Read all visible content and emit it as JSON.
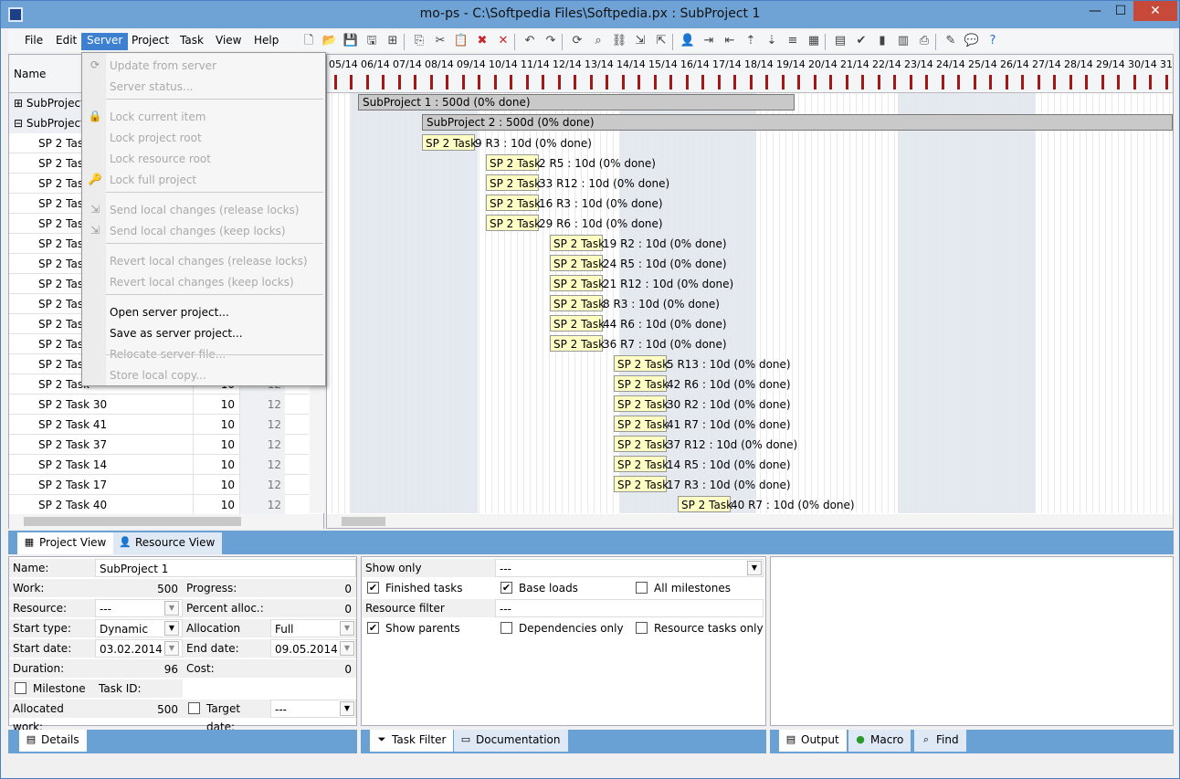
{
  "window": {
    "title": "mo-ps - C:\\Softpedia Files\\Softpedia.px : SubProject 1"
  },
  "menubar": [
    "File",
    "Edit",
    "Server",
    "Project",
    "Task",
    "View",
    "Help"
  ],
  "server_menu": {
    "items": [
      {
        "label": "Update from server",
        "enabled": false
      },
      {
        "label": "Server status...",
        "enabled": false
      },
      {
        "label": "Lock current item",
        "enabled": false
      },
      {
        "label": "Lock project root",
        "enabled": false
      },
      {
        "label": "Lock resource root",
        "enabled": false
      },
      {
        "label": "Lock full project",
        "enabled": false
      },
      {
        "label": "Send local changes (release locks)",
        "enabled": false
      },
      {
        "label": "Send local changes (keep locks)",
        "enabled": false
      },
      {
        "label": "Revert local changes (release locks)",
        "enabled": false
      },
      {
        "label": "Revert local changes (keep locks)",
        "enabled": false
      },
      {
        "label": "Open server project...",
        "enabled": true
      },
      {
        "label": "Save as server project...",
        "enabled": true
      },
      {
        "label": "Relocate server file...",
        "enabled": false
      },
      {
        "label": "Store local copy...",
        "enabled": false
      }
    ]
  },
  "grid": {
    "header_name": "Name",
    "rows": [
      {
        "name": "SubProject",
        "dur": "",
        "wk": "",
        "group": true,
        "marker": "⊞"
      },
      {
        "name": "SubProject",
        "dur": "",
        "wk": "",
        "group": true,
        "marker": "⊟"
      },
      {
        "name": "SP 2 Task",
        "dur": "",
        "wk": ""
      },
      {
        "name": "SP 2 Task",
        "dur": "",
        "wk": ""
      },
      {
        "name": "SP 2 Task",
        "dur": "",
        "wk": ""
      },
      {
        "name": "SP 2 Task",
        "dur": "",
        "wk": ""
      },
      {
        "name": "SP 2 Task",
        "dur": "",
        "wk": ""
      },
      {
        "name": "SP 2 Task",
        "dur": "",
        "wk": ""
      },
      {
        "name": "SP 2 Task",
        "dur": "",
        "wk": ""
      },
      {
        "name": "SP 2 Task",
        "dur": "",
        "wk": ""
      },
      {
        "name": "SP 2 Task",
        "dur": "",
        "wk": ""
      },
      {
        "name": "SP 2 Task",
        "dur": "",
        "wk": ""
      },
      {
        "name": "SP 2 Task",
        "dur": "",
        "wk": ""
      },
      {
        "name": "SP 2 Task",
        "dur": "",
        "wk": ""
      },
      {
        "name": "SP 2 Task",
        "dur": "10",
        "wk": "12"
      },
      {
        "name": "SP 2 Task 30",
        "dur": "10",
        "wk": "12"
      },
      {
        "name": "SP 2 Task 41",
        "dur": "10",
        "wk": "12"
      },
      {
        "name": "SP 2 Task 37",
        "dur": "10",
        "wk": "12"
      },
      {
        "name": "SP 2 Task 14",
        "dur": "10",
        "wk": "12"
      },
      {
        "name": "SP 2 Task 17",
        "dur": "10",
        "wk": "12"
      },
      {
        "name": "SP 2 Task 40",
        "dur": "10",
        "wk": "12"
      }
    ]
  },
  "gantt": {
    "dates": [
      "05/14",
      "06/14",
      "07/14",
      "08/14",
      "09/14",
      "10/14",
      "11/14",
      "12/14",
      "13/14",
      "14/14",
      "15/14",
      "16/14",
      "17/14",
      "18/14",
      "19/14",
      "20/14",
      "21/14",
      "22/14",
      "23/14",
      "24/14",
      "25/14",
      "26/14",
      "27/14",
      "28/14",
      "29/14",
      "30/14",
      "31/"
    ],
    "summary_bars": [
      {
        "label": "SubProject 1  : 500d (0% done)"
      },
      {
        "label": "SubProject 2  : 500d (0% done)"
      }
    ],
    "tasks": [
      {
        "box": "SP 2 Task",
        "rest": "9 R3 : 10d (0% done)",
        "col": 0
      },
      {
        "box": "SP 2 Task",
        "rest": "2 R5 : 10d (0% done)",
        "col": 1
      },
      {
        "box": "SP 2 Task",
        "rest": "33 R12 : 10d (0% done)",
        "col": 1
      },
      {
        "box": "SP 2 Task",
        "rest": "16 R3 : 10d (0% done)",
        "col": 1
      },
      {
        "box": "SP 2 Task",
        "rest": "29 R6 : 10d (0% done)",
        "col": 1
      },
      {
        "box": "SP 2 Task",
        "rest": "19 R2 : 10d (0% done)",
        "col": 2
      },
      {
        "box": "SP 2 Task",
        "rest": "24 R5 : 10d (0% done)",
        "col": 2
      },
      {
        "box": "SP 2 Task",
        "rest": "21 R12 : 10d (0% done)",
        "col": 2
      },
      {
        "box": "SP 2 Task",
        "rest": "8 R3 : 10d (0% done)",
        "col": 2
      },
      {
        "box": "SP 2 Task",
        "rest": "44 R6 : 10d (0% done)",
        "col": 2
      },
      {
        "box": "SP 2 Task",
        "rest": "36 R7 : 10d (0% done)",
        "col": 2
      },
      {
        "box": "SP 2 Task",
        "rest": "5 R13 : 10d (0% done)",
        "col": 3
      },
      {
        "box": "SP 2 Task",
        "rest": "42 R6 : 10d (0% done)",
        "col": 3
      },
      {
        "box": "SP 2 Task",
        "rest": "30 R2 : 10d (0% done)",
        "col": 3
      },
      {
        "box": "SP 2 Task",
        "rest": "41 R7 : 10d (0% done)",
        "col": 3
      },
      {
        "box": "SP 2 Task",
        "rest": "37 R12 : 10d (0% done)",
        "col": 3
      },
      {
        "box": "SP 2 Task",
        "rest": "14 R5 : 10d (0% done)",
        "col": 3
      },
      {
        "box": "SP 2 Task",
        "rest": "17 R3 : 10d (0% done)",
        "col": 3
      },
      {
        "box": "SP 2 Task",
        "rest": "40 R7 : 10d (0% done)",
        "col": 4
      }
    ]
  },
  "view_tabs": [
    {
      "label": "Project View",
      "icon": "project-view-icon"
    },
    {
      "label": "Resource View",
      "icon": "resource-view-icon"
    }
  ],
  "details": {
    "name_label": "Name:",
    "name_value": "SubProject 1",
    "work_label": "Work:",
    "work_value": "500",
    "progress_label": "Progress:",
    "progress_value": "0",
    "resource_label": "Resource:",
    "resource_value": "---",
    "percent_label": "Percent alloc.:",
    "percent_value": "0",
    "starttype_label": "Start type:",
    "starttype_value": "Dynamic",
    "alloctype_label": "Allocation type:",
    "alloctype_value": "Full",
    "startdate_label": "Start date:",
    "startdate_value": "03.02.2014",
    "enddate_label": "End date:",
    "enddate_value": "09.05.2014",
    "duration_label": "Duration:",
    "duration_value": "96",
    "cost_label": "Cost:",
    "cost_value": "0",
    "milestone_label": "Milestone",
    "taskid_label": "Task ID:",
    "allocwork_label": "Allocated work:",
    "allocwork_value": "500",
    "targetdate_label": "Target date:",
    "targetdate_value": "---"
  },
  "filter": {
    "showonly_label": "Show only",
    "showonly_value": "---",
    "finished_label": "Finished tasks",
    "baseloads_label": "Base loads",
    "allmilestones_label": "All milestones",
    "resfilter_label": "Resource filter",
    "resfilter_value": "---",
    "showparents_label": "Show parents",
    "deponly_label": "Dependencies only",
    "restasks_label": "Resource tasks only"
  },
  "panel_tabs": {
    "left": [
      {
        "label": "Details",
        "icon": "details-icon"
      }
    ],
    "mid": [
      {
        "label": "Task Filter",
        "icon": "filter-icon"
      },
      {
        "label": "Documentation",
        "icon": "documentation-icon"
      }
    ],
    "right": [
      {
        "label": "Output",
        "icon": "output-icon"
      },
      {
        "label": "Macro",
        "icon": "macro-icon"
      },
      {
        "label": "Find",
        "icon": "find-icon"
      }
    ]
  },
  "toolbar_icons": [
    "new-icon",
    "open-icon",
    "save-icon",
    "save-as-icon",
    "tree-icon",
    "copy-icon",
    "cut-icon",
    "paste-icon",
    "delete-icon",
    "close-x-icon",
    "undo-icon",
    "redo-icon",
    "refresh-icon",
    "search-icon",
    "link-icon",
    "import-icon",
    "export-icon",
    "user-icon",
    "indent-icon",
    "outdent-icon",
    "move-up-icon",
    "move-down-icon",
    "level-icon",
    "calendar-icon",
    "calculator-icon",
    "check-icon",
    "chart-icon",
    "report-icon",
    "print-icon",
    "tools-icon",
    "chat-icon",
    "help-icon"
  ]
}
